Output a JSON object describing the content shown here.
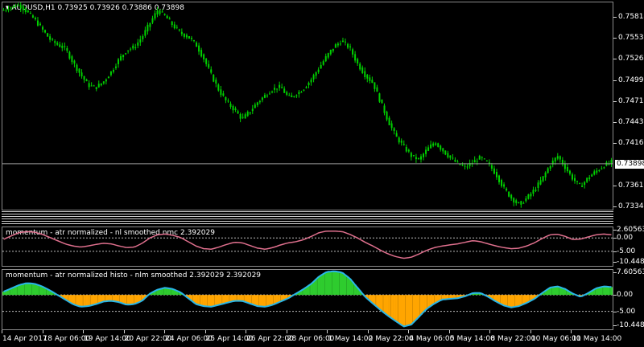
{
  "main": {
    "title": "▾ AUDUSD,H1  0.73925 0.73926 0.73886 0.73898",
    "yrange": [
      0.733,
      0.76
    ],
    "price_ticks": [
      "0.75814",
      "0.75535",
      "0.75264",
      "0.74990",
      "0.74717",
      "0.74439",
      "0.74166",
      "0.73898",
      "0.73619",
      "0.73344"
    ],
    "current_price": "0.73898",
    "candle_color": "#00d000",
    "series_close": [
      0.759,
      0.7594,
      0.7597,
      0.7588,
      0.7578,
      0.7565,
      0.7552,
      0.7545,
      0.754,
      0.7522,
      0.7506,
      0.7492,
      0.7489,
      0.7497,
      0.751,
      0.7526,
      0.7538,
      0.7542,
      0.7555,
      0.7573,
      0.759,
      0.7582,
      0.757,
      0.756,
      0.7555,
      0.7545,
      0.7527,
      0.7505,
      0.7485,
      0.747,
      0.746,
      0.7448,
      0.7458,
      0.747,
      0.7479,
      0.7487,
      0.749,
      0.7476,
      0.748,
      0.7488,
      0.75,
      0.7515,
      0.753,
      0.7543,
      0.755,
      0.754,
      0.752,
      0.7505,
      0.7495,
      0.747,
      0.7445,
      0.7425,
      0.7412,
      0.74,
      0.7395,
      0.7408,
      0.7418,
      0.7408,
      0.7398,
      0.739,
      0.7385,
      0.7392,
      0.7398,
      0.739,
      0.7376,
      0.7358,
      0.7345,
      0.7336,
      0.7345,
      0.7356,
      0.737,
      0.7388,
      0.74,
      0.7385,
      0.737,
      0.736,
      0.7372,
      0.738,
      0.7387,
      0.7392
    ]
  },
  "ind1": {
    "title": "momentum - atr normalized - nl smoothed nmc 2.392029",
    "ticks": [
      "2.605630",
      "0.00",
      "-5.00",
      "-10.448124"
    ],
    "line_color": "#e0708e",
    "values": [
      -0.5,
      0.8,
      2.0,
      2.4,
      2.2,
      1.4,
      0.2,
      -1.0,
      -2.2,
      -3.0,
      -3.4,
      -3.0,
      -2.4,
      -2.0,
      -2.2,
      -3.0,
      -3.6,
      -3.4,
      -2.0,
      0.0,
      1.2,
      1.5,
      1.0,
      0.2,
      -1.4,
      -3.0,
      -4.0,
      -4.2,
      -3.4,
      -2.4,
      -1.6,
      -1.8,
      -2.8,
      -3.8,
      -4.2,
      -3.6,
      -2.6,
      -1.8,
      -1.4,
      -0.6,
      0.6,
      2.0,
      2.6,
      2.6,
      2.4,
      1.4,
      0.0,
      -1.6,
      -3.0,
      -4.6,
      -6.0,
      -7.0,
      -7.6,
      -7.2,
      -6.0,
      -4.6,
      -3.6,
      -3.0,
      -2.6,
      -2.2,
      -1.6,
      -1.0,
      -1.4,
      -2.2,
      -3.0,
      -3.6,
      -4.0,
      -3.8,
      -3.0,
      -1.8,
      -0.2,
      1.2,
      1.4,
      0.6,
      -0.6,
      -0.4,
      0.4,
      1.2,
      1.5,
      1.2
    ]
  },
  "ind2": {
    "title": "momentum - atr normalized histo - nlm smoothed 2.392029 2.392029",
    "ticks": [
      "7.605630",
      "0.00",
      "-5.00",
      "-10.448124"
    ],
    "line_color": "#29b6e8",
    "pos_color": "#2ecc2e",
    "neg_color": "#ffa500",
    "values": [
      1.0,
      2.0,
      3.0,
      3.6,
      3.4,
      2.6,
      1.4,
      0.0,
      -1.4,
      -2.8,
      -3.6,
      -3.4,
      -2.8,
      -2.0,
      -1.8,
      -2.2,
      -3.0,
      -2.8,
      -1.8,
      0.4,
      1.6,
      2.2,
      1.8,
      0.8,
      -1.0,
      -2.8,
      -3.4,
      -3.6,
      -3.0,
      -2.4,
      -1.8,
      -1.8,
      -2.6,
      -3.4,
      -3.6,
      -3.0,
      -2.0,
      -1.0,
      0.4,
      1.8,
      3.4,
      5.6,
      7.0,
      7.2,
      6.8,
      5.0,
      2.2,
      -0.6,
      -2.6,
      -4.6,
      -6.4,
      -8.0,
      -9.6,
      -9.0,
      -6.6,
      -4.2,
      -2.6,
      -1.4,
      -1.2,
      -1.0,
      -0.4,
      0.6,
      0.6,
      -0.6,
      -2.0,
      -3.2,
      -3.8,
      -3.4,
      -2.4,
      -1.2,
      0.6,
      2.2,
      2.6,
      1.8,
      0.4,
      -0.6,
      0.6,
      2.0,
      2.6,
      2.4
    ]
  },
  "xaxis": {
    "labels": [
      "14 Apr 2017",
      "18 Apr 06:00",
      "19 Apr 14:00",
      "20 Apr 22:00",
      "24 Apr 06:00",
      "25 Apr 14:00",
      "26 Apr 22:00",
      "28 Apr 06:00",
      "1 May 14:00",
      "2 May 22:00",
      "4 May 06:00",
      "5 May 14:00",
      "8 May 22:00",
      "10 May 06:00",
      "11 May 14:00"
    ]
  }
}
